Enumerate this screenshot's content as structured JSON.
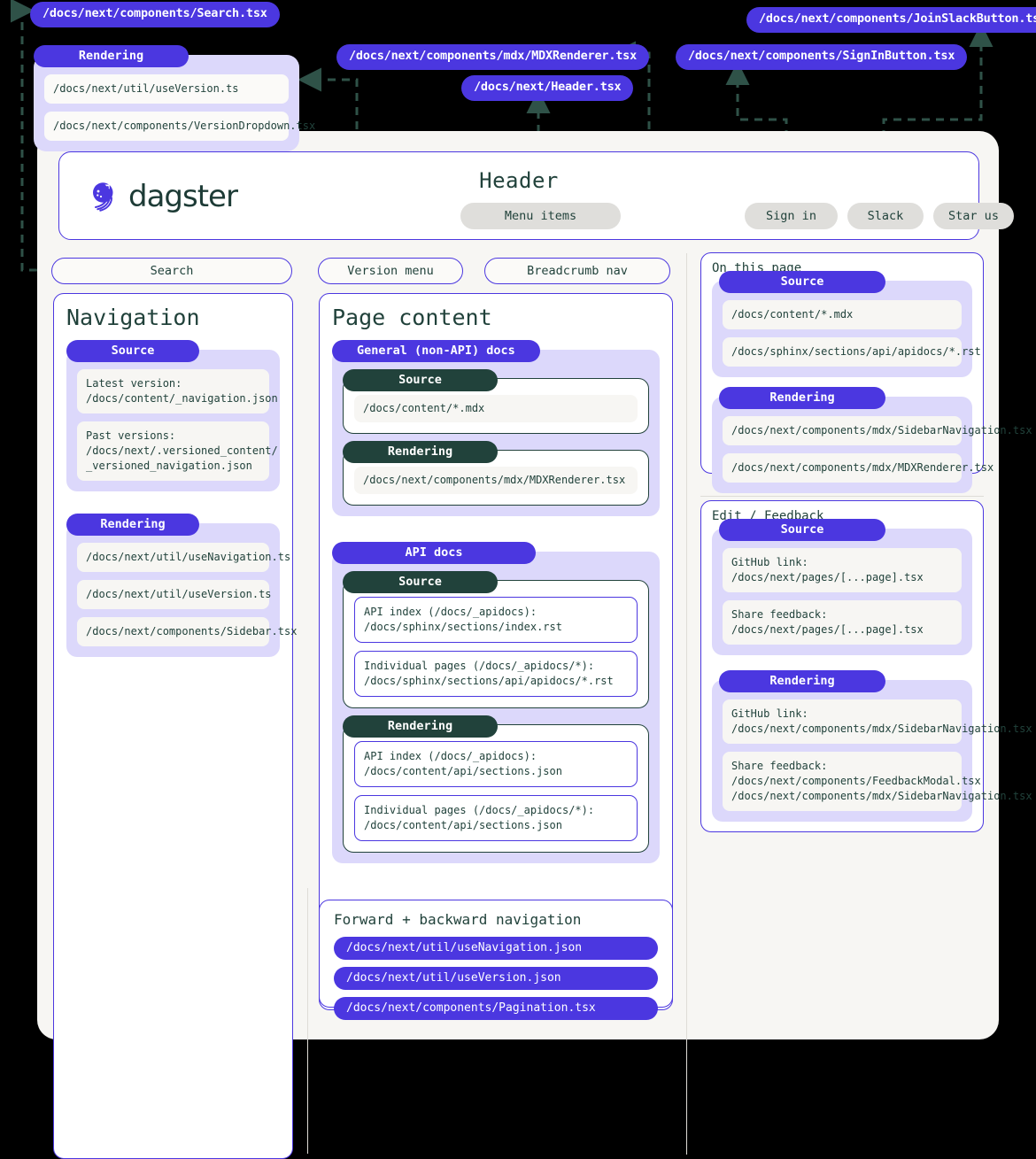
{
  "colors": {
    "accent_purple": "#4b37e0",
    "lavender": "#dcd8fb",
    "dark_green": "#21423b",
    "window_bg": "#f7f6f3",
    "grey_pill": "#dfdedb",
    "arrow_green": "#2f5248"
  },
  "callouts": {
    "search": "/docs/next/components/Search.tsx",
    "mdx_renderer": "/docs/next/components/mdx/MDXRenderer.tsx",
    "header": "/docs/next/Header.tsx",
    "sign_in_button": "/docs/next/components/SignInButton.tsx",
    "join_slack_button": "/docs/next/components/JoinSlackButton.tsx"
  },
  "version_callout": {
    "tab": "Rendering",
    "items": [
      "/docs/next/util/useVersion.ts",
      "/docs/next/components/VersionDropdown.tsx"
    ]
  },
  "header": {
    "title": "Header",
    "logo_text": "dagster",
    "logo_icon": "dagster-whale-icon",
    "menu_items_label": "Menu items",
    "buttons": [
      "Sign in",
      "Slack",
      "Star us"
    ]
  },
  "lozenges": {
    "search": "Search",
    "version_menu": "Version menu",
    "breadcrumb_nav": "Breadcrumb nav"
  },
  "navigation_panel": {
    "title": "Navigation",
    "groups": [
      {
        "tab": "Source",
        "items": [
          "Latest version:\n/docs/content/_navigation.json",
          "Past versions:\n/docs/next/.versioned_content/\n_versioned_navigation.json"
        ]
      },
      {
        "tab": "Rendering",
        "items": [
          "/docs/next/util/useNavigation.ts",
          "/docs/next/util/useVersion.ts",
          "/docs/next/components/Sidebar.tsx"
        ]
      }
    ]
  },
  "page_content_panel": {
    "title": "Page content",
    "groups": [
      {
        "tab": "General (non-API) docs",
        "cards": [
          {
            "tab": "Source",
            "items": [
              {
                "text": "/docs/content/*.mdx",
                "outlined": false
              }
            ]
          },
          {
            "tab": "Rendering",
            "items": [
              {
                "text": "/docs/next/components/mdx/MDXRenderer.tsx",
                "outlined": false
              }
            ]
          }
        ]
      },
      {
        "tab": "API docs",
        "cards": [
          {
            "tab": "Source",
            "items": [
              {
                "text": "API index (/docs/_apidocs):\n/docs/sphinx/sections/index.rst",
                "outlined": true
              },
              {
                "text": "Individual pages (/docs/_apidocs/*):\n/docs/sphinx/sections/api/apidocs/*.rst",
                "outlined": true
              }
            ]
          },
          {
            "tab": "Rendering",
            "items": [
              {
                "text": "API index (/docs/_apidocs):\n/docs/content/api/sections.json",
                "outlined": true
              },
              {
                "text": "Individual pages (/docs/_apidocs/*):\n/docs/content/api/sections.json",
                "outlined": true
              }
            ]
          }
        ]
      }
    ]
  },
  "pagination_panel": {
    "title": "Forward + backward navigation",
    "rows": [
      "/docs/next/util/useNavigation.json",
      "/docs/next/util/useVersion.json",
      "/docs/next/components/Pagination.tsx"
    ]
  },
  "on_this_page_panel": {
    "title": "On this page",
    "groups": [
      {
        "tab": "Source",
        "items": [
          "/docs/content/*.mdx",
          "/docs/sphinx/sections/api/apidocs/*.rst"
        ]
      },
      {
        "tab": "Rendering",
        "items": [
          "/docs/next/components/mdx/SidebarNavigation.tsx",
          "/docs/next/components/mdx/MDXRenderer.tsx"
        ]
      }
    ]
  },
  "edit_feedback_panel": {
    "title": "Edit / Feedback",
    "groups": [
      {
        "tab": "Source",
        "items": [
          "GitHub link:\n/docs/next/pages/[...page].tsx",
          "Share feedback:\n/docs/next/pages/[...page].tsx"
        ]
      },
      {
        "tab": "Rendering",
        "items": [
          "GitHub link:\n/docs/next/components/mdx/SidebarNavigation.tsx",
          "Share feedback:\n/docs/next/components/FeedbackModal.tsx\n/docs/next/components/mdx/SidebarNavigation.tsx"
        ]
      }
    ]
  }
}
